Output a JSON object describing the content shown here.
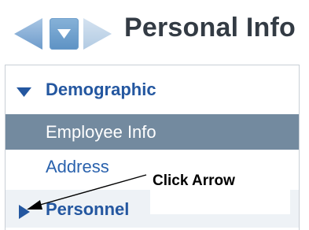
{
  "page_title": "Personal Info",
  "nav_buttons": {
    "back": "arrow-left-icon",
    "menu": "chevron-down-icon",
    "forward": "arrow-right-icon"
  },
  "panel": {
    "sections": [
      {
        "label": "Demographic",
        "expanded": true,
        "icon": "triangle-down-icon",
        "items": [
          {
            "label": "Employee Info",
            "selected": true
          },
          {
            "label": "Address",
            "selected": false
          }
        ]
      },
      {
        "label": "Personnel",
        "expanded": false,
        "icon": "triangle-right-icon"
      }
    ]
  },
  "annotation": {
    "text": "Click Arrow"
  },
  "colors": {
    "accent": "#2457a0",
    "link": "#2a62ad",
    "selected_row": "#738a9f",
    "nav_arrow": "#7fa7cf",
    "title": "#333b44"
  }
}
